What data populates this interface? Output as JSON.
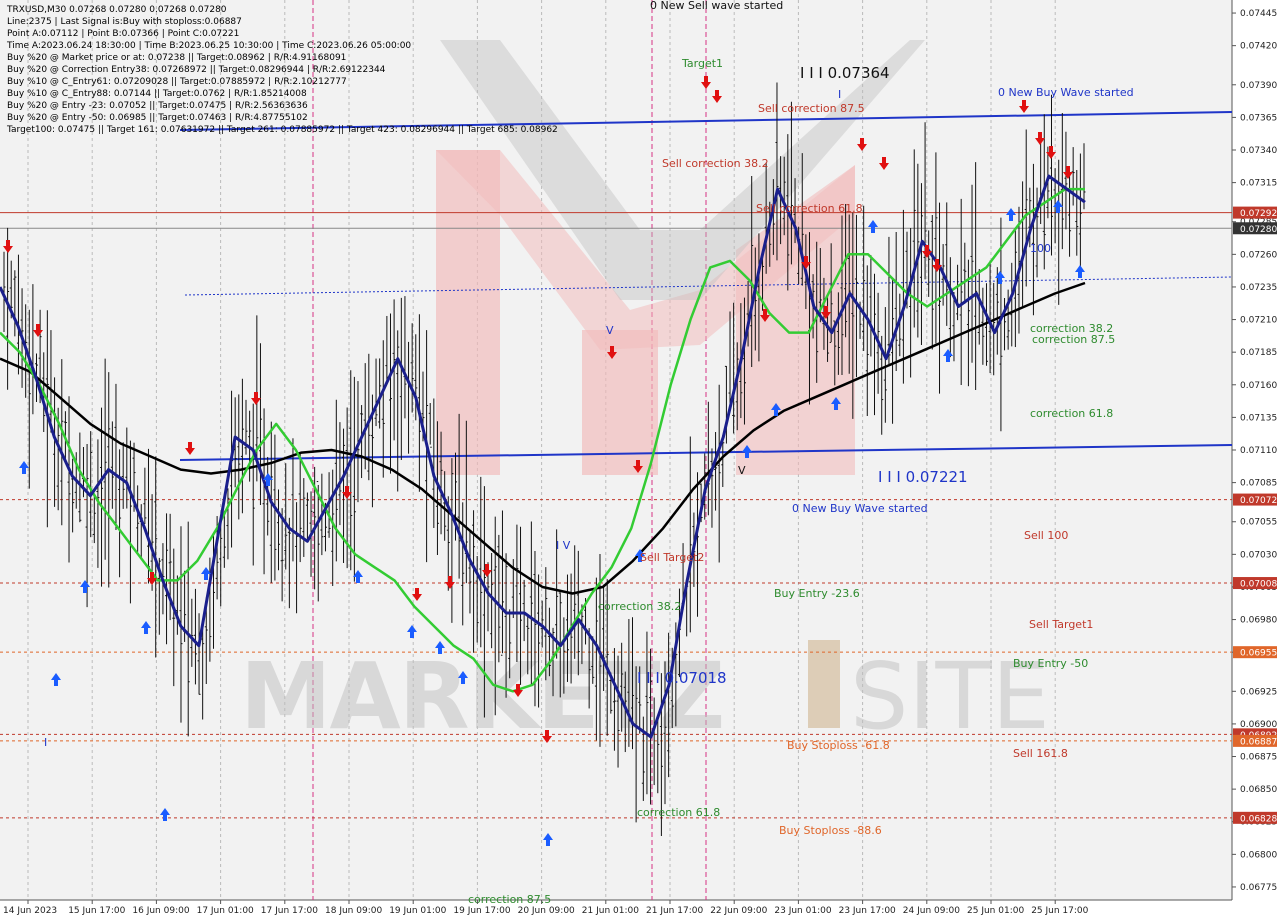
{
  "info": {
    "lines": [
      "TRXUSD,M30  0.07268 0.07280 0.07268 0.07280",
      "Line:2375 | Last Signal is:Buy with stoploss:0.06887",
      "Point A:0.07112 | Point B:0.07366 | Point C:0.07221",
      "Time A:2023.06.24 18:30:00 | Time B:2023.06.25 10:30:00 | Time C:2023.06.26 05:00:00",
      "Buy %20 @ Market price or at: 0.07238 || Target:0.08962 | R/R:4.91168091",
      "Buy %20 @ Correction Entry38: 0.07268972 || Target:0.08296944 | R/R:2.69122344",
      "Buy %10 @ C_Entry61: 0.07209028 || Target:0.07885972 | R/R:2.10212777",
      "Buy %10 @ C_Entry88: 0.07144 || Target:0.0762 | R/R:1.85214008",
      "Buy %20 @ Entry -23: 0.07052 || Target:0.07475 | R/R:2.56363636",
      "Buy %20 @ Entry -50: 0.06985 || Target:0.07463 | R/R:4.87755102",
      "Target100: 0.07475 || Target 161: 0.07631972 || Target 261: 0.07885972 || Target 423: 0.08296944 || Target 685: 0.08962"
    ]
  },
  "watermark": {
    "brand_left": "MARKETZ",
    "brand_i": "I",
    "brand_right": "SITE"
  },
  "colors": {
    "background": "#f2f2f2",
    "axis_bg": "#ffffff",
    "ma_fast": "#1a1f8c",
    "ma_mid": "#33cc33",
    "ma_slow": "#000000",
    "channel": "#1f35c8",
    "buy_arrow": "#1a5cff",
    "sell_arrow": "#e01010",
    "price_box": "#c0392b",
    "level_line": "#c0392b"
  },
  "chart_data": {
    "type": "candlestick",
    "symbol": "TRXUSD",
    "timeframe": "M30",
    "ylim": [
      0.06765,
      0.07455
    ],
    "y_ticks": [
      "0.07445",
      "0.07420",
      "0.07390",
      "0.07365",
      "0.07340",
      "0.07315",
      "0.07285",
      "0.07260",
      "0.07235",
      "0.07210",
      "0.07185",
      "0.07160",
      "0.07135",
      "0.07110",
      "0.07085",
      "0.07055",
      "0.07030",
      "0.07005",
      "0.06980",
      "0.06955",
      "0.06925",
      "0.06900",
      "0.06875",
      "0.06850",
      "0.06825",
      "0.06800",
      "0.06775"
    ],
    "x_ticks": [
      "14 Jun 2023",
      "15 Jun 17:00",
      "16 Jun 09:00",
      "17 Jun 01:00",
      "17 Jun 17:00",
      "18 Jun 09:00",
      "19 Jun 01:00",
      "19 Jun 17:00",
      "20 Jun 09:00",
      "21 Jun 01:00",
      "21 Jun 17:00",
      "22 Jun 09:00",
      "23 Jun 01:00",
      "23 Jun 17:00",
      "24 Jun 09:00",
      "25 Jun 01:00",
      "25 Jun 17:00"
    ],
    "price_boxes": [
      {
        "label": "0.07292",
        "value": 0.07292,
        "color": "#c0392b"
      },
      {
        "label": "0.07280",
        "value": 0.0728,
        "color": "#333333"
      },
      {
        "label": "0.07072",
        "value": 0.07072,
        "color": "#c0392b"
      },
      {
        "label": "0.07008",
        "value": 0.07008,
        "color": "#c0392b"
      },
      {
        "label": "0.06955",
        "value": 0.06955,
        "color": "#e0662a"
      },
      {
        "label": "0.06892",
        "value": 0.06892,
        "color": "#c0392b"
      },
      {
        "label": "0.06887",
        "value": 0.06887,
        "color": "#e0662a"
      },
      {
        "label": "0.06828",
        "value": 0.06828,
        "color": "#c0392b"
      }
    ],
    "levels": [
      {
        "value": 0.07292,
        "style": "solid",
        "color": "#c0392b"
      },
      {
        "value": 0.0728,
        "style": "solid",
        "color": "#888888"
      },
      {
        "value": 0.07072,
        "style": "dashed",
        "color": "#c0392b"
      },
      {
        "value": 0.07008,
        "style": "dashed",
        "color": "#c0392b"
      },
      {
        "value": 0.06955,
        "style": "dashed",
        "color": "#e0662a"
      },
      {
        "value": 0.06892,
        "style": "dashed",
        "color": "#c0392b"
      },
      {
        "value": 0.06887,
        "style": "dashed",
        "color": "#e0662a"
      },
      {
        "value": 0.06828,
        "style": "dashed",
        "color": "#c0392b"
      }
    ],
    "annotations": [
      {
        "text": "0 New Sell wave started",
        "cls": "lvl-black"
      },
      {
        "text": "I I I 0.07364",
        "cls": "lvl-black-big"
      },
      {
        "text": "Sell correction 87.5",
        "cls": "lvl-red"
      },
      {
        "text": "Sell correction 61.8",
        "cls": "lvl-red"
      },
      {
        "text": "Sell correction 38.2",
        "cls": "lvl-red"
      },
      {
        "text": "Target1",
        "cls": "lvl-green"
      },
      {
        "text": "100",
        "cls": "lvl-blue"
      },
      {
        "text": "correction 38.2",
        "cls": "lvl-green"
      },
      {
        "text": "correction 61.8",
        "cls": "lvl-green"
      },
      {
        "text": "correction 87.5",
        "cls": "lvl-green"
      },
      {
        "text": "I I I 0.07221",
        "cls": "lvl-blue-big"
      },
      {
        "text": "0 New Buy Wave started",
        "cls": "lvl-blue"
      },
      {
        "text": "Sell 100",
        "cls": "lvl-red"
      },
      {
        "text": "Buy Entry -23.6",
        "cls": "lvl-green"
      },
      {
        "text": "Sell Target1",
        "cls": "lvl-red"
      },
      {
        "text": "Buy Entry -50",
        "cls": "lvl-green"
      },
      {
        "text": "Buy Stoploss -61.8",
        "cls": "lvl-orange"
      },
      {
        "text": "Sell 161.8",
        "cls": "lvl-red"
      },
      {
        "text": "Buy Stoploss -88.6",
        "cls": "lvl-orange"
      },
      {
        "text": "Sell Target2",
        "cls": "lvl-red"
      },
      {
        "text": "correction 38.2",
        "cls": "lvl-green"
      },
      {
        "text": "I I I 0.07018",
        "cls": "lvl-blue-big"
      },
      {
        "text": "correction 61.8",
        "cls": "lvl-green"
      },
      {
        "text": "correction 87.5",
        "cls": "lvl-green"
      },
      {
        "text": "0 New Buy Wave started",
        "cls": "lvl-blue"
      },
      {
        "text": "I",
        "cls": "lvl-blue"
      },
      {
        "text": "V",
        "cls": "lvl-blue"
      },
      {
        "text": "I",
        "cls": "lvl-blue"
      },
      {
        "text": "V",
        "cls": "lvl-black"
      },
      {
        "text": "I V",
        "cls": "lvl-blue"
      },
      {
        "text": "I V",
        "cls": "lvl-black"
      }
    ],
    "series": [
      {
        "name": "",
        "kind": "ma_fast",
        "values": [
          0.07235,
          0.07205,
          0.07165,
          0.0712,
          0.0709,
          0.07075,
          0.07095,
          0.07085,
          0.0705,
          0.0701,
          0.06975,
          0.0696,
          0.0704,
          0.0712,
          0.0711,
          0.0707,
          0.0705,
          0.0704,
          0.07065,
          0.0709,
          0.0712,
          0.0715,
          0.0718,
          0.0715,
          0.0709,
          0.0706,
          0.07025,
          0.07,
          0.06985,
          0.06985,
          0.06975,
          0.0696,
          0.0698,
          0.0696,
          0.0693,
          0.069,
          0.0689,
          0.0693,
          0.0701,
          0.0708,
          0.0712,
          0.0718,
          0.0725,
          0.0731,
          0.0728,
          0.0722,
          0.072,
          0.0723,
          0.0721,
          0.0718,
          0.0722,
          0.0727,
          0.0725,
          0.0722,
          0.0723,
          0.072,
          0.0723,
          0.0728,
          0.0732,
          0.0731,
          0.073
        ]
      },
      {
        "name": "",
        "kind": "ma_mid",
        "values": [
          0.072,
          0.07185,
          0.0716,
          0.0713,
          0.07095,
          0.0707,
          0.0705,
          0.0703,
          0.0701,
          0.0701,
          0.07025,
          0.0705,
          0.0708,
          0.0711,
          0.0713,
          0.0711,
          0.0708,
          0.0705,
          0.0703,
          0.0702,
          0.0701,
          0.0699,
          0.06975,
          0.0696,
          0.0695,
          0.0693,
          0.06925,
          0.0693,
          0.0695,
          0.06975,
          0.07,
          0.0702,
          0.0705,
          0.071,
          0.0716,
          0.0721,
          0.0725,
          0.07255,
          0.0724,
          0.07215,
          0.072,
          0.072,
          0.0723,
          0.0726,
          0.0726,
          0.07245,
          0.0723,
          0.0722,
          0.0723,
          0.0724,
          0.0725,
          0.0727,
          0.0729,
          0.073,
          0.0731,
          0.0731
        ]
      },
      {
        "name": "",
        "kind": "ma_slow",
        "values": [
          0.0718,
          0.0717,
          0.0715,
          0.0713,
          0.07115,
          0.07105,
          0.07095,
          0.07092,
          0.07095,
          0.071,
          0.07108,
          0.0711,
          0.07105,
          0.07095,
          0.0708,
          0.0706,
          0.0704,
          0.0702,
          0.07005,
          0.07,
          0.07005,
          0.07025,
          0.0705,
          0.0708,
          0.07105,
          0.07125,
          0.0714,
          0.0715,
          0.0716,
          0.0717,
          0.0718,
          0.0719,
          0.072,
          0.0721,
          0.0722,
          0.0723,
          0.07238
        ]
      }
    ]
  }
}
